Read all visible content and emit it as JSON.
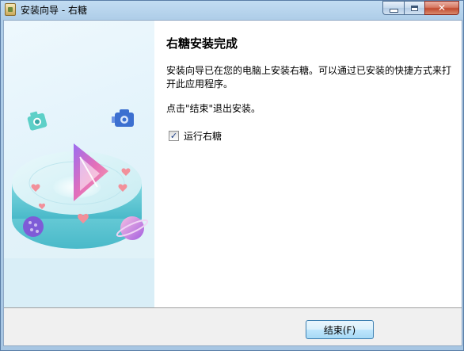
{
  "window": {
    "title": "安装向导 - 右糖",
    "close_glyph": "✕"
  },
  "page": {
    "heading": "右糖安装完成",
    "message": "安装向导已在您的电脑上安装右糖。可以通过已安装的快捷方式来打开此应用程序。",
    "finish_hint": "点击\"结束\"退出安装。",
    "run_checkbox": {
      "label": "运行右糖",
      "checked": true,
      "check_glyph": "✓"
    }
  },
  "footer": {
    "finish_label": "结束(F)"
  },
  "colors": {
    "accent_pink": "#f05fa0",
    "accent_purple": "#8b5ce0",
    "accent_teal": "#3cbfc0",
    "accent_blue": "#3c6fd0"
  },
  "icons": {
    "side_art": [
      "cube-platform-illustration",
      "camera-icon",
      "video-camera-icon",
      "play-logo-icon",
      "heart-icon",
      "planet-icon"
    ]
  }
}
